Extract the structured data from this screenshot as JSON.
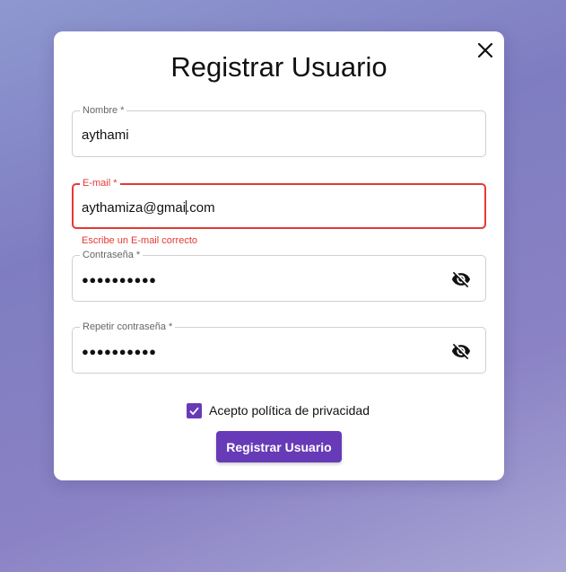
{
  "modal": {
    "title": "Registrar Usuario",
    "close_icon": "close-icon"
  },
  "form": {
    "nombre": {
      "label": "Nombre *",
      "value": "aythami"
    },
    "email": {
      "label": "E-mail *",
      "value_before_caret": "aythamiza@gmai",
      "value_after_caret": ".com",
      "error": "Escribe un E-mail correcto"
    },
    "password": {
      "label": "Contraseña *",
      "value": "●●●●●●●●●●",
      "icon": "eye-off-icon"
    },
    "password_repeat": {
      "label": "Repetir contraseña *",
      "value": "●●●●●●●●●●",
      "icon": "eye-off-icon"
    },
    "privacy": {
      "label": "Acepto política de privacidad",
      "checked": true
    },
    "submit_label": "Registrar Usuario"
  },
  "colors": {
    "primary": "#673ab7",
    "error": "#e53935"
  }
}
